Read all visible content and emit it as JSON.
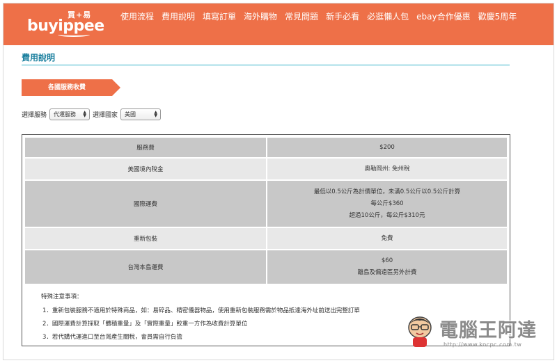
{
  "brand": {
    "logo_top": "買+易",
    "logo_main": "buyippee"
  },
  "nav": [
    {
      "label": "使用流程"
    },
    {
      "label": "費用說明"
    },
    {
      "label": "填寫訂單"
    },
    {
      "label": "海外購物"
    },
    {
      "label": "常見問題"
    },
    {
      "label": "新手必看"
    },
    {
      "label": "必逛懶人包"
    },
    {
      "label": "ebay合作優惠"
    },
    {
      "label": "歡慶5周年"
    }
  ],
  "page": {
    "title": "費用說明"
  },
  "section": {
    "tab_label": "各國服務收費"
  },
  "filters": {
    "service_label": "選擇服務",
    "service_value": "代運服務",
    "country_label": "選擇國家",
    "country_value": "美國"
  },
  "table": {
    "rows": [
      {
        "key": "服務費",
        "value": [
          "$200"
        ]
      },
      {
        "key": "美國境內稅金",
        "value": [
          "奧勒岡州: 免州稅"
        ]
      },
      {
        "key": "國際運費",
        "value": [
          "最低以0.5公斤為計價單位，未滿0.5公斤以0.5公斤計算",
          "每公斤$360",
          "超過10公斤，每公斤$310元"
        ]
      },
      {
        "key": "重新包裝",
        "value": [
          "免費"
        ]
      },
      {
        "key": "台灣本島運費",
        "value": [
          "$60",
          "離島及偏遠區另外計費"
        ]
      }
    ]
  },
  "notes": {
    "title": "特殊注意事項：",
    "items": [
      "1．重新包裝服務不適用於特殊商品，如：易碎品、精密儀器物品，使用重新包裝服務需於物品抵達海外址前送出完整訂單",
      "2．國際運費計算採取「體積重量」及「實際重量」較重一方作為收費計算單位",
      "3．若代購代運進口至台灣產生關稅，會員需自行負擔"
    ]
  },
  "watermark": {
    "text": "電腦王阿達",
    "url": "http://www.kocpc.com.tw"
  },
  "colors": {
    "brand": "#ee7048",
    "accent": "#2fb0c8",
    "title": "#1a7f9e",
    "row_dark": "#c8c8c8",
    "row_light": "#e8e8e8"
  }
}
